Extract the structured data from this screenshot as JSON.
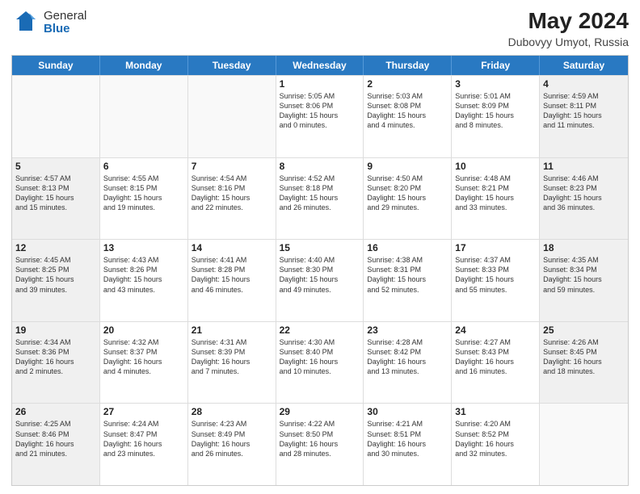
{
  "header": {
    "logo_general": "General",
    "logo_blue": "Blue",
    "month_year": "May 2024",
    "location": "Dubovyy Umyot, Russia"
  },
  "days_of_week": [
    "Sunday",
    "Monday",
    "Tuesday",
    "Wednesday",
    "Thursday",
    "Friday",
    "Saturday"
  ],
  "weeks": [
    [
      {
        "day": "",
        "info": ""
      },
      {
        "day": "",
        "info": ""
      },
      {
        "day": "",
        "info": ""
      },
      {
        "day": "1",
        "info": "Sunrise: 5:05 AM\nSunset: 8:06 PM\nDaylight: 15 hours\nand 0 minutes."
      },
      {
        "day": "2",
        "info": "Sunrise: 5:03 AM\nSunset: 8:08 PM\nDaylight: 15 hours\nand 4 minutes."
      },
      {
        "day": "3",
        "info": "Sunrise: 5:01 AM\nSunset: 8:09 PM\nDaylight: 15 hours\nand 8 minutes."
      },
      {
        "day": "4",
        "info": "Sunrise: 4:59 AM\nSunset: 8:11 PM\nDaylight: 15 hours\nand 11 minutes."
      }
    ],
    [
      {
        "day": "5",
        "info": "Sunrise: 4:57 AM\nSunset: 8:13 PM\nDaylight: 15 hours\nand 15 minutes."
      },
      {
        "day": "6",
        "info": "Sunrise: 4:55 AM\nSunset: 8:15 PM\nDaylight: 15 hours\nand 19 minutes."
      },
      {
        "day": "7",
        "info": "Sunrise: 4:54 AM\nSunset: 8:16 PM\nDaylight: 15 hours\nand 22 minutes."
      },
      {
        "day": "8",
        "info": "Sunrise: 4:52 AM\nSunset: 8:18 PM\nDaylight: 15 hours\nand 26 minutes."
      },
      {
        "day": "9",
        "info": "Sunrise: 4:50 AM\nSunset: 8:20 PM\nDaylight: 15 hours\nand 29 minutes."
      },
      {
        "day": "10",
        "info": "Sunrise: 4:48 AM\nSunset: 8:21 PM\nDaylight: 15 hours\nand 33 minutes."
      },
      {
        "day": "11",
        "info": "Sunrise: 4:46 AM\nSunset: 8:23 PM\nDaylight: 15 hours\nand 36 minutes."
      }
    ],
    [
      {
        "day": "12",
        "info": "Sunrise: 4:45 AM\nSunset: 8:25 PM\nDaylight: 15 hours\nand 39 minutes."
      },
      {
        "day": "13",
        "info": "Sunrise: 4:43 AM\nSunset: 8:26 PM\nDaylight: 15 hours\nand 43 minutes."
      },
      {
        "day": "14",
        "info": "Sunrise: 4:41 AM\nSunset: 8:28 PM\nDaylight: 15 hours\nand 46 minutes."
      },
      {
        "day": "15",
        "info": "Sunrise: 4:40 AM\nSunset: 8:30 PM\nDaylight: 15 hours\nand 49 minutes."
      },
      {
        "day": "16",
        "info": "Sunrise: 4:38 AM\nSunset: 8:31 PM\nDaylight: 15 hours\nand 52 minutes."
      },
      {
        "day": "17",
        "info": "Sunrise: 4:37 AM\nSunset: 8:33 PM\nDaylight: 15 hours\nand 55 minutes."
      },
      {
        "day": "18",
        "info": "Sunrise: 4:35 AM\nSunset: 8:34 PM\nDaylight: 15 hours\nand 59 minutes."
      }
    ],
    [
      {
        "day": "19",
        "info": "Sunrise: 4:34 AM\nSunset: 8:36 PM\nDaylight: 16 hours\nand 2 minutes."
      },
      {
        "day": "20",
        "info": "Sunrise: 4:32 AM\nSunset: 8:37 PM\nDaylight: 16 hours\nand 4 minutes."
      },
      {
        "day": "21",
        "info": "Sunrise: 4:31 AM\nSunset: 8:39 PM\nDaylight: 16 hours\nand 7 minutes."
      },
      {
        "day": "22",
        "info": "Sunrise: 4:30 AM\nSunset: 8:40 PM\nDaylight: 16 hours\nand 10 minutes."
      },
      {
        "day": "23",
        "info": "Sunrise: 4:28 AM\nSunset: 8:42 PM\nDaylight: 16 hours\nand 13 minutes."
      },
      {
        "day": "24",
        "info": "Sunrise: 4:27 AM\nSunset: 8:43 PM\nDaylight: 16 hours\nand 16 minutes."
      },
      {
        "day": "25",
        "info": "Sunrise: 4:26 AM\nSunset: 8:45 PM\nDaylight: 16 hours\nand 18 minutes."
      }
    ],
    [
      {
        "day": "26",
        "info": "Sunrise: 4:25 AM\nSunset: 8:46 PM\nDaylight: 16 hours\nand 21 minutes."
      },
      {
        "day": "27",
        "info": "Sunrise: 4:24 AM\nSunset: 8:47 PM\nDaylight: 16 hours\nand 23 minutes."
      },
      {
        "day": "28",
        "info": "Sunrise: 4:23 AM\nSunset: 8:49 PM\nDaylight: 16 hours\nand 26 minutes."
      },
      {
        "day": "29",
        "info": "Sunrise: 4:22 AM\nSunset: 8:50 PM\nDaylight: 16 hours\nand 28 minutes."
      },
      {
        "day": "30",
        "info": "Sunrise: 4:21 AM\nSunset: 8:51 PM\nDaylight: 16 hours\nand 30 minutes."
      },
      {
        "day": "31",
        "info": "Sunrise: 4:20 AM\nSunset: 8:52 PM\nDaylight: 16 hours\nand 32 minutes."
      },
      {
        "day": "",
        "info": ""
      }
    ]
  ]
}
